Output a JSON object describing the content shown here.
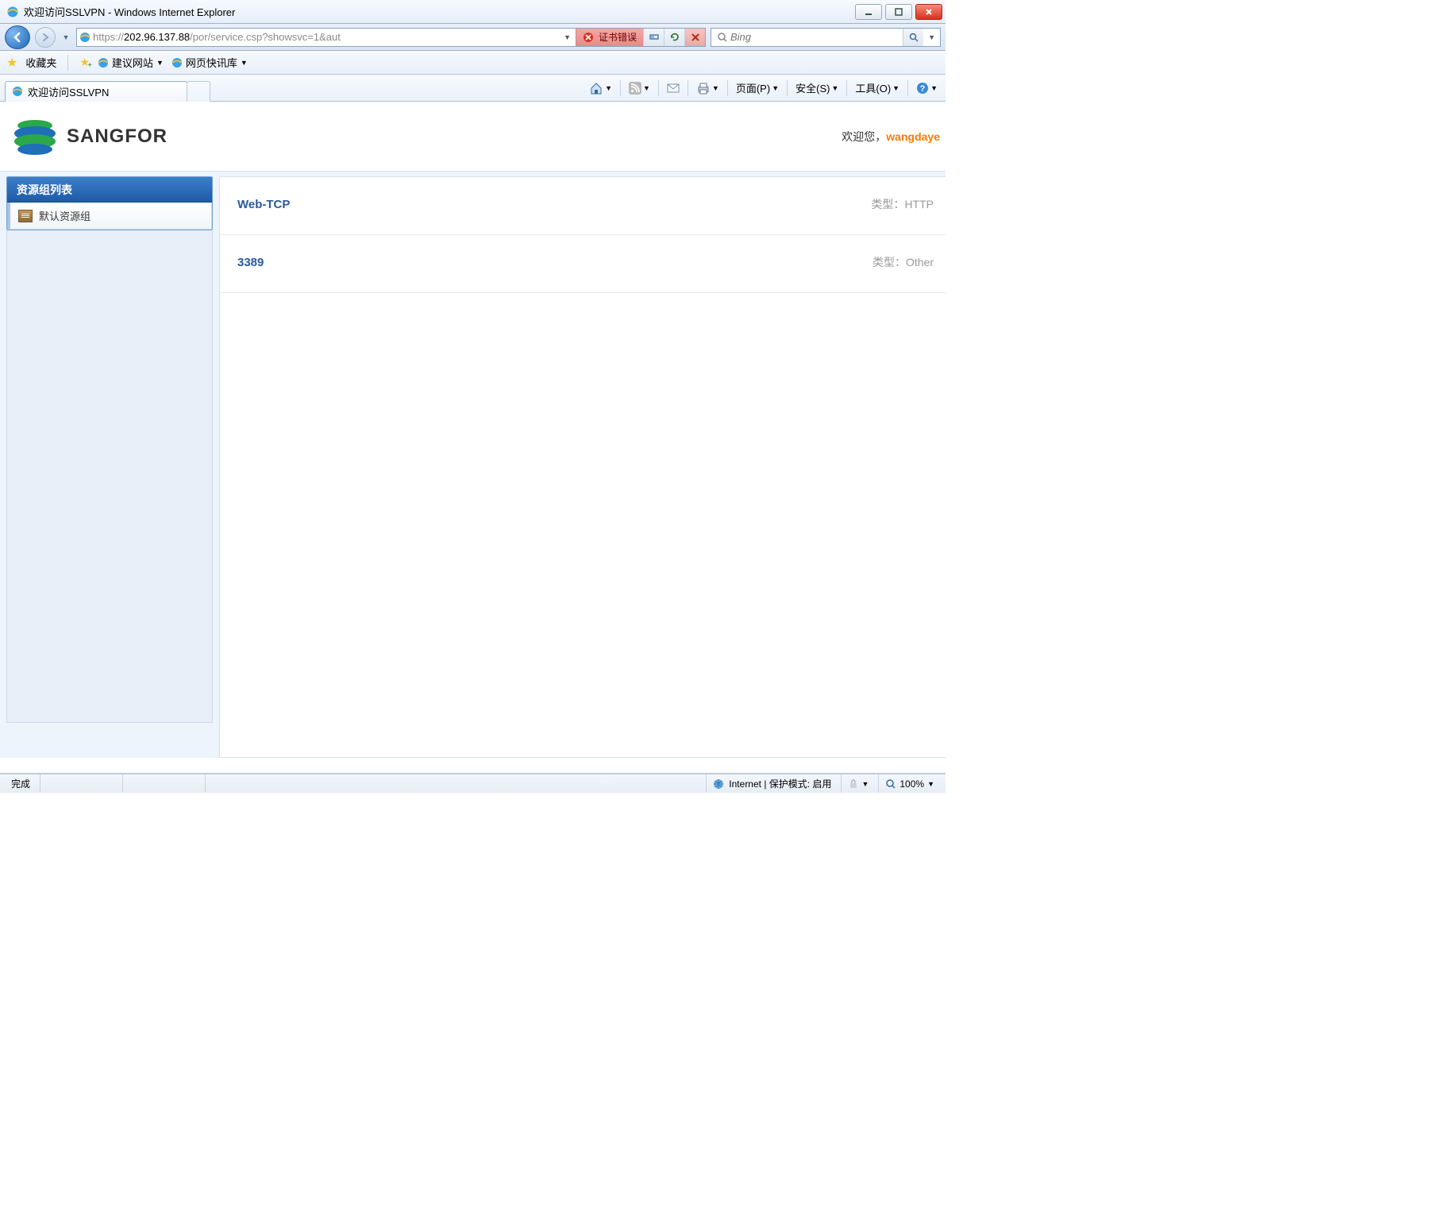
{
  "window": {
    "title": "欢迎访问SSLVPN - Windows Internet Explorer"
  },
  "address": {
    "scheme": "https://",
    "host": "202.96.137.88",
    "path": "/por/service.csp?showsvc=1&aut",
    "cert_error_label": "证书错误"
  },
  "search": {
    "placeholder": "Bing"
  },
  "favorites": {
    "label": "收藏夹",
    "suggest": "建议网站",
    "webslice": "网页快讯库"
  },
  "tab": {
    "title": "欢迎访问SSLVPN"
  },
  "cmd": {
    "page": "页面(P)",
    "safety": "安全(S)",
    "tools": "工具(O)"
  },
  "app": {
    "brand": "SANGFOR",
    "welcome_prefix": "欢迎您，",
    "user": "wangdaye"
  },
  "sidebar": {
    "title": "资源组列表",
    "items": [
      {
        "label": "默认资源组"
      }
    ]
  },
  "resources": {
    "type_prefix": "类型：",
    "rows": [
      {
        "name": "Web-TCP",
        "type": "HTTP"
      },
      {
        "name": "3389",
        "type": "Other"
      }
    ]
  },
  "status": {
    "done": "完成",
    "zone": "Internet | 保护模式: 启用",
    "zoom": "100%"
  }
}
